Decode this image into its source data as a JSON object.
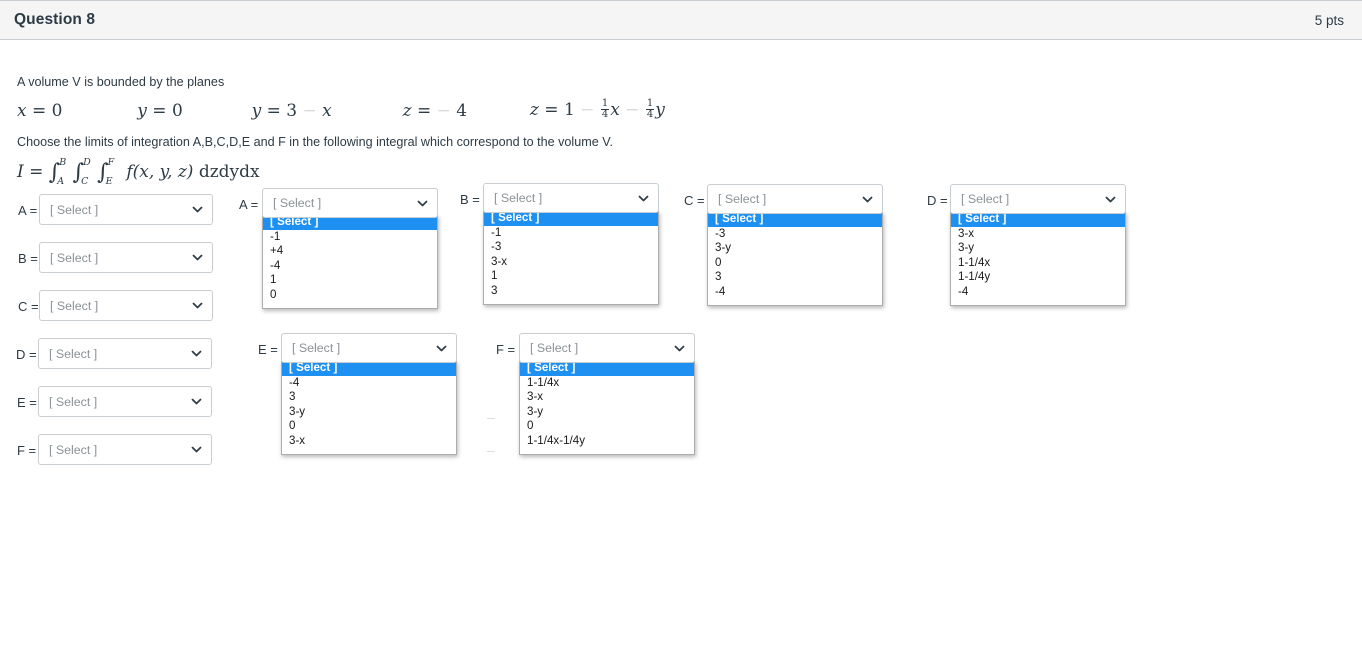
{
  "header": {
    "title": "Question 8",
    "points": "5 pts"
  },
  "body": {
    "intro": "A volume V is bounded by the planes",
    "instruction": "Choose the limits of integration A,B,C,D,E and F in the following integral which correspond to the volume V.",
    "planes": [
      {
        "lhs": "x",
        "eq": "=",
        "rhs": "0"
      },
      {
        "lhs": "y",
        "eq": "=",
        "rhs": "0"
      },
      {
        "lhs": "y",
        "eq": "=",
        "rhs": "3 - x"
      },
      {
        "lhs": "z",
        "eq": "=",
        "rhs": "- 4"
      },
      {
        "lhs": "z",
        "eq": "=",
        "rhs": "1 - 1/4 x - 1/4 y"
      }
    ],
    "integral": {
      "lhs": "I",
      "equals": "=",
      "outer_upper": "B",
      "outer_lower": "A",
      "middle_upper": "D",
      "middle_lower": "C",
      "inner_upper": "F",
      "inner_lower": "E",
      "integrand": "f(x, y, z)",
      "differentials": "dzdydx"
    }
  },
  "selects": {
    "placeholder": "[ Select ]",
    "column_left": [
      {
        "label": "A =",
        "value": "[ Select ]"
      },
      {
        "label": "B =",
        "value": "[ Select ]"
      },
      {
        "label": "C =",
        "value": "[ Select ]"
      },
      {
        "label": "D =",
        "value": "[ Select ]"
      },
      {
        "label": "E =",
        "value": "[ Select ]"
      },
      {
        "label": "F =",
        "value": "[ Select ]"
      }
    ],
    "open": [
      {
        "id": "A",
        "label": "A =",
        "value": "[ Select ]",
        "options": [
          "[ Select ]",
          "-1",
          "+4",
          "-4",
          "1",
          "0"
        ],
        "highlighted_index": 0
      },
      {
        "id": "B",
        "label": "B =",
        "value": "[ Select ]",
        "options": [
          "[ Select ]",
          "-1",
          "-3",
          "3-x",
          "1",
          "3"
        ],
        "highlighted_index": 0
      },
      {
        "id": "C",
        "label": "C =",
        "value": "[ Select ]",
        "options": [
          "[ Select ]",
          "-3",
          "3-y",
          "0",
          "3",
          "-4"
        ],
        "highlighted_index": 0
      },
      {
        "id": "D",
        "label": "D =",
        "value": "[ Select ]",
        "options": [
          "[ Select ]",
          "3-x",
          "3-y",
          "1-1/4x",
          "1-1/4y",
          "-4"
        ],
        "highlighted_index": 0
      },
      {
        "id": "E",
        "label": "E =",
        "value": "[ Select ]",
        "options": [
          "[ Select ]",
          "-4",
          "3",
          "3-y",
          "0",
          "3-x"
        ],
        "highlighted_index": 0
      },
      {
        "id": "F",
        "label": "F =",
        "value": "[ Select ]",
        "options": [
          "[ Select ]",
          "1-1/4x",
          "3-x",
          "3-y",
          "0",
          "1-1/4x-1/4y"
        ],
        "highlighted_index": 0
      }
    ]
  },
  "colors": {
    "header_bg": "#f5f5f5",
    "text": "#2d3b45",
    "border": "#c7cdd1",
    "highlight": "#1e90f2",
    "placeholder_text": "#8b9296"
  }
}
